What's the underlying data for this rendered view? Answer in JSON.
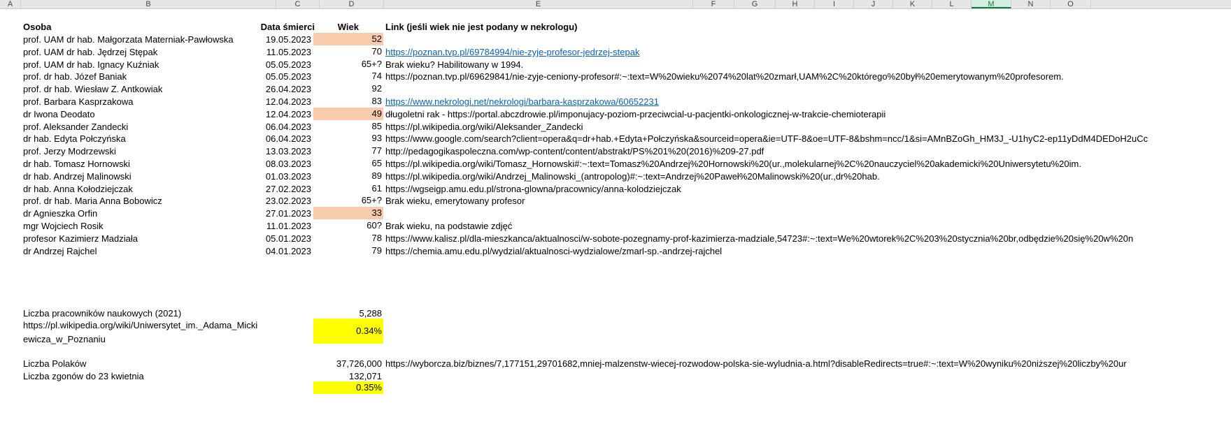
{
  "columns": [
    "A",
    "B",
    "C",
    "D",
    "E",
    "F",
    "G",
    "H",
    "I",
    "J",
    "K",
    "L",
    "M",
    "N",
    "O"
  ],
  "headers": {
    "osoba": "Osoba",
    "data": "Data śmierci",
    "wiek": "Wiek",
    "link": "Link (jeśli wiek nie jest podany w nekrologu)"
  },
  "rows": [
    {
      "name": "prof. UAM dr hab. Małgorzata Materniak-Pawłowska",
      "date": "19.05.2023",
      "age": "52",
      "link": "",
      "hl": true,
      "is_link": false
    },
    {
      "name": "prof. UAM dr hab. Jędrzej Stępak",
      "date": "11.05.2023",
      "age": "70",
      "link": "https://poznan.tvp.pl/69784994/nie-zyje-profesor-jedrzej-stepak",
      "hl": false,
      "is_link": true
    },
    {
      "name": "prof. UAM dr hab. Ignacy Kuźniak",
      "date": "05.05.2023",
      "age": "65+?",
      "link": "Brak wieku? Habilitowany w 1994.",
      "hl": false,
      "is_link": false
    },
    {
      "name": "prof. dr hab. Józef Baniak",
      "date": "05.05.2023",
      "age": "74",
      "link": "https://poznan.tvp.pl/69629841/nie-zyje-ceniony-profesor#:~:text=W%20wieku%2074%20lat%20zmarł,UAM%2C%20którego%20był%20emerytowanym%20profesorem.",
      "hl": false,
      "is_link": false
    },
    {
      "name": "prof. dr hab. Wiesław Z. Antkowiak",
      "date": "26.04.2023",
      "age": "92",
      "link": "",
      "hl": false,
      "is_link": false
    },
    {
      "name": "prof. Barbara Kasprzakowa",
      "date": "12.04.2023",
      "age": "83",
      "link": "https://www.nekrologi.net/nekrologi/barbara-kasprzakowa/60652231",
      "hl": false,
      "is_link": true
    },
    {
      "name": "dr Iwona Deodato",
      "date": "12.04.2023",
      "age": "49",
      "link": "długoletni rak - https://portal.abczdrowie.pl/imponujacy-poziom-przeciwcial-u-pacjentki-onkologicznej-w-trakcie-chemioterapii",
      "hl": true,
      "is_link": false
    },
    {
      "name": "prof. Aleksander Zandecki",
      "date": "06.04.2023",
      "age": "85",
      "link": "https://pl.wikipedia.org/wiki/Aleksander_Zandecki",
      "hl": false,
      "is_link": false
    },
    {
      "name": "dr hab. Edyta Połczyńska",
      "date": "06.04.2023",
      "age": "93",
      "link": "https://www.google.com/search?client=opera&q=dr+hab.+Edyta+Połczyńska&sourceid=opera&ie=UTF-8&oe=UTF-8&bshm=ncc/1&si=AMnBZoGh_HM3J_-U1hyC2-ep11yDdM4DEDoH2uCc",
      "hl": false,
      "is_link": false
    },
    {
      "name": "prof. Jerzy Modrzewski",
      "date": "13.03.2023",
      "age": "77",
      "link": "http://pedagogikaspoleczna.com/wp-content/content/abstrakt/PS%201%20(2016)%209-27.pdf",
      "hl": false,
      "is_link": false
    },
    {
      "name": "dr hab. Tomasz Hornowski",
      "date": "08.03.2023",
      "age": "65",
      "link": "https://pl.wikipedia.org/wiki/Tomasz_Hornowski#:~:text=Tomasz%20Andrzej%20Hornowski%20(ur.,molekularnej%2C%20nauczyciel%20akademicki%20Uniwersytetu%20im.",
      "hl": false,
      "is_link": false
    },
    {
      "name": "dr hab. Andrzej Malinowski",
      "date": "01.03.2023",
      "age": "89",
      "link": "https://pl.wikipedia.org/wiki/Andrzej_Malinowski_(antropolog)#:~:text=Andrzej%20Paweł%20Malinowski%20(ur.,dr%20hab.",
      "hl": false,
      "is_link": false
    },
    {
      "name": "dr hab. Anna Kołodziejczak",
      "date": "27.02.2023",
      "age": "61",
      "link": "https://wgseigp.amu.edu.pl/strona-glowna/pracownicy/anna-kolodziejczak",
      "hl": false,
      "is_link": false
    },
    {
      "name": "prof. dr hab. Maria Anna Bobowicz",
      "date": "23.02.2023",
      "age": "65+?",
      "link": "Brak wieku, emerytowany profesor",
      "hl": false,
      "is_link": false
    },
    {
      "name": "dr Agnieszka Orfin",
      "date": "27.01.2023",
      "age": "33",
      "link": "",
      "hl": true,
      "is_link": false
    },
    {
      "name": "mgr Wojciech Rosik",
      "date": "11.01.2023",
      "age": "60?",
      "link": "Brak wieku, na podstawie zdjęć",
      "hl": false,
      "is_link": false
    },
    {
      "name": "profesor Kazimierz Madziała",
      "date": "05.01.2023",
      "age": "78",
      "link": "https://www.kalisz.pl/dla-mieszkanca/aktualnosci/w-sobote-pozegnamy-prof-kazimierza-madziale,54723#:~:text=We%20wtorek%2C%203%20stycznia%20br,odbędzie%20się%20w%20n",
      "hl": false,
      "is_link": false
    },
    {
      "name": "dr Andrzej Rajchel",
      "date": "04.01.2023",
      "age": "79",
      "link": "https://chemia.amu.edu.pl/wydzial/aktualnosci-wydzialowe/zmarl-sp.-andrzej-rajchel",
      "hl": false,
      "is_link": false
    }
  ],
  "summary": {
    "staff_label": "Liczba pracowników naukowych (2021)",
    "staff_value": "5,288",
    "wiki_link": "https://pl.wikipedia.org/wiki/Uniwersytet_im._Adama_Mickiewicza_w_Poznaniu",
    "staff_pct": "0.34%",
    "poles_label": "Liczba Polaków",
    "poles_value": "37,726,000",
    "poles_link": "https://wyborcza.biz/biznes/7,177151,29701682,mniej-malzenstw-wiecej-rozwodow-polska-sie-wyludnia-a.html?disableRedirects=true#:~:text=W%20wyniku%20niższej%20liczby%20ur",
    "deaths_label": "Liczba zgonów do 23 kwietnia",
    "deaths_value": "132,071",
    "deaths_pct": "0.35%"
  },
  "colors": {
    "highlight_orange": "#f8cbad",
    "highlight_yellow": "#ffff00",
    "link": "#0563c1"
  }
}
